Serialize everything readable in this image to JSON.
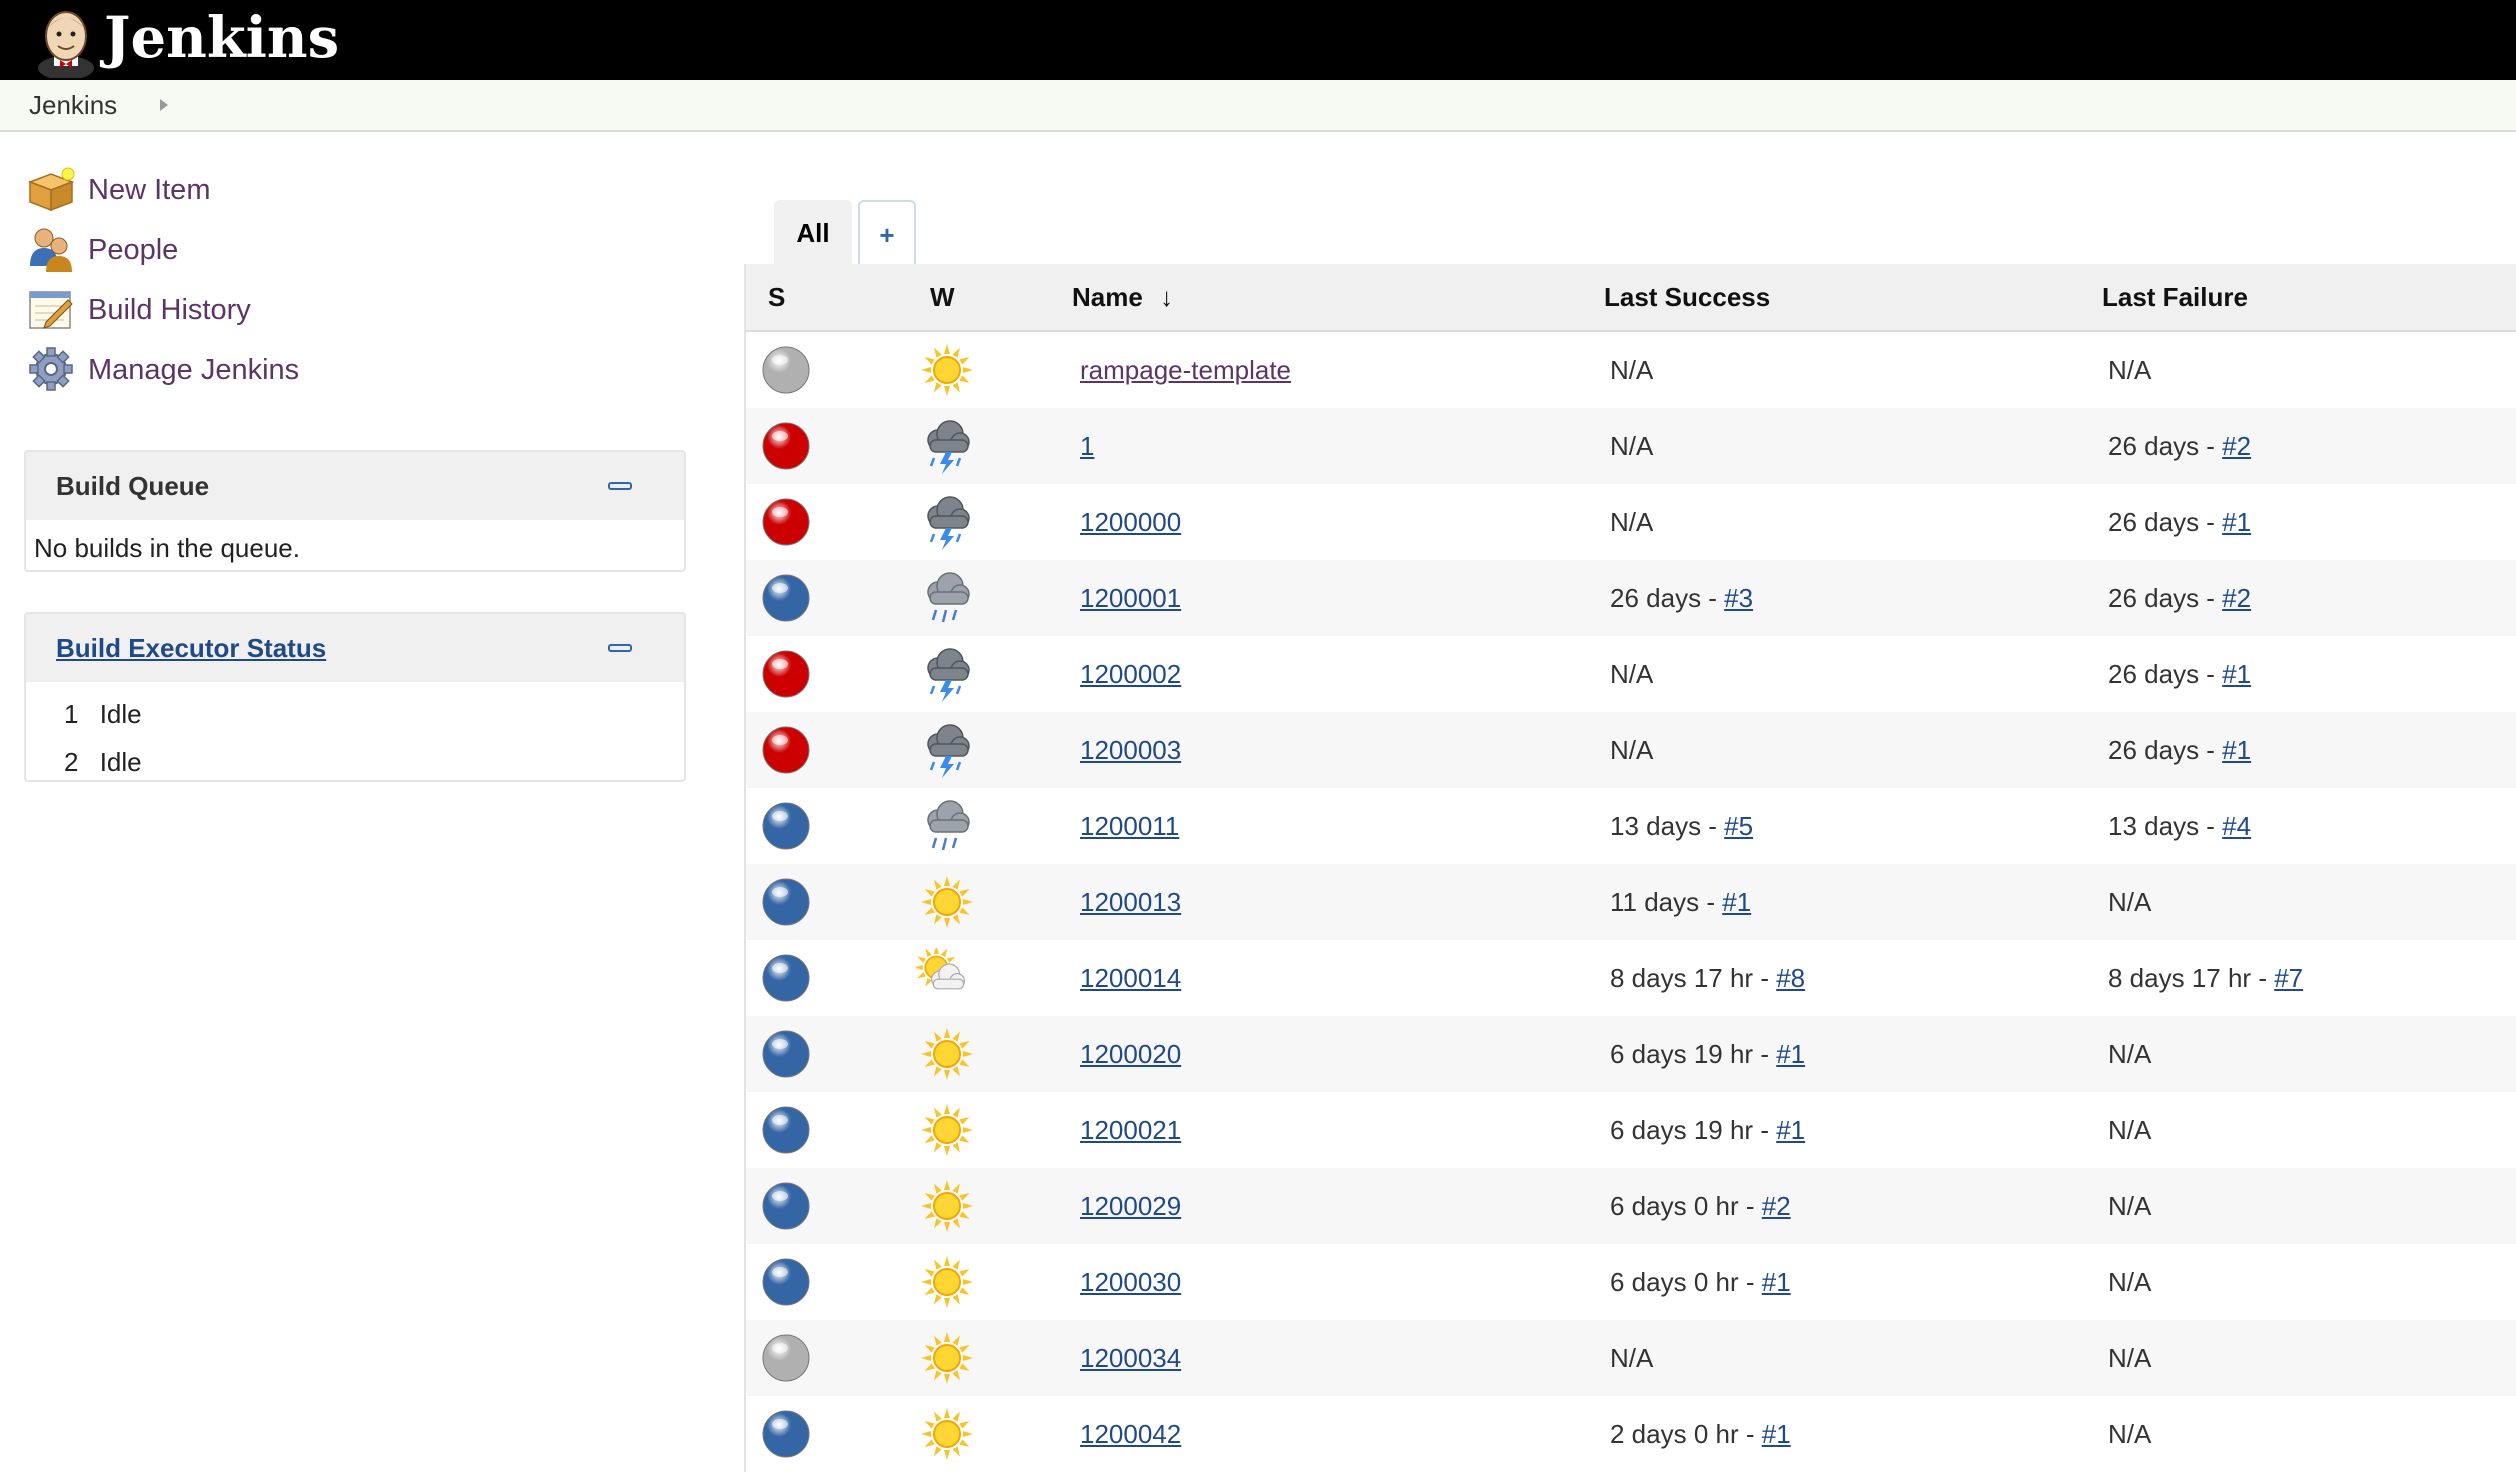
{
  "header": {
    "brand": "Jenkins",
    "logo_icon": "jenkins-butler-logo-icon"
  },
  "breadcrumb": {
    "root": "Jenkins"
  },
  "tasks": [
    {
      "label": "New Item",
      "icon": "new-item-box-icon"
    },
    {
      "label": "People",
      "icon": "people-icon"
    },
    {
      "label": "Build History",
      "icon": "notepad-icon"
    },
    {
      "label": "Manage Jenkins",
      "icon": "gear-icon"
    }
  ],
  "build_queue": {
    "title": "Build Queue",
    "empty_text": "No builds in the queue."
  },
  "executors": {
    "title": "Build Executor Status",
    "rows": [
      {
        "num": "1",
        "status": "Idle"
      },
      {
        "num": "2",
        "status": "Idle"
      }
    ]
  },
  "tabs": {
    "all": "All",
    "add": "+"
  },
  "table": {
    "headers": {
      "s": "S",
      "w": "W",
      "name": "Name",
      "sort": "↓",
      "last_success": "Last Success",
      "last_failure": "Last Failure"
    },
    "rows": [
      {
        "name": "rampage-template",
        "status": "disabled",
        "weather": "sunny",
        "success_text": "N/A",
        "success_link": "",
        "failure_text": "N/A",
        "failure_link": ""
      },
      {
        "name": "1",
        "status": "failed",
        "weather": "thunderstorm",
        "success_text": "N/A",
        "success_link": "",
        "failure_text": "26 days - ",
        "failure_link": "#2"
      },
      {
        "name": "1200000",
        "status": "failed",
        "weather": "thunderstorm",
        "success_text": "N/A",
        "success_link": "",
        "failure_text": "26 days - ",
        "failure_link": "#1"
      },
      {
        "name": "1200001",
        "status": "success",
        "weather": "rain",
        "success_text": "26 days - ",
        "success_link": "#3",
        "failure_text": "26 days - ",
        "failure_link": "#2"
      },
      {
        "name": "1200002",
        "status": "failed",
        "weather": "thunderstorm",
        "success_text": "N/A",
        "success_link": "",
        "failure_text": "26 days - ",
        "failure_link": "#1"
      },
      {
        "name": "1200003",
        "status": "failed",
        "weather": "thunderstorm",
        "success_text": "N/A",
        "success_link": "",
        "failure_text": "26 days - ",
        "failure_link": "#1"
      },
      {
        "name": "1200011",
        "status": "success",
        "weather": "rain",
        "success_text": "13 days - ",
        "success_link": "#5",
        "failure_text": "13 days - ",
        "failure_link": "#4"
      },
      {
        "name": "1200013",
        "status": "success",
        "weather": "sunny",
        "success_text": "11 days - ",
        "success_link": "#1",
        "failure_text": "N/A",
        "failure_link": ""
      },
      {
        "name": "1200014",
        "status": "success",
        "weather": "partly-cloudy",
        "success_text": "8 days 17 hr - ",
        "success_link": "#8",
        "failure_text": "8 days 17 hr - ",
        "failure_link": "#7"
      },
      {
        "name": "1200020",
        "status": "success",
        "weather": "sunny",
        "success_text": "6 days 19 hr - ",
        "success_link": "#1",
        "failure_text": "N/A",
        "failure_link": ""
      },
      {
        "name": "1200021",
        "status": "success",
        "weather": "sunny",
        "success_text": "6 days 19 hr - ",
        "success_link": "#1",
        "failure_text": "N/A",
        "failure_link": ""
      },
      {
        "name": "1200029",
        "status": "success",
        "weather": "sunny",
        "success_text": "6 days 0 hr - ",
        "success_link": "#2",
        "failure_text": "N/A",
        "failure_link": ""
      },
      {
        "name": "1200030",
        "status": "success",
        "weather": "sunny",
        "success_text": "6 days 0 hr - ",
        "success_link": "#1",
        "failure_text": "N/A",
        "failure_link": ""
      },
      {
        "name": "1200034",
        "status": "disabled",
        "weather": "sunny",
        "success_text": "N/A",
        "success_link": "",
        "failure_text": "N/A",
        "failure_link": ""
      },
      {
        "name": "1200042",
        "status": "success",
        "weather": "sunny",
        "success_text": "2 days 0 hr - ",
        "success_link": "#1",
        "failure_text": "N/A",
        "failure_link": ""
      }
    ]
  },
  "colors": {
    "header_bg": "#000000",
    "link": "#204a87",
    "task_link": "#5c3566",
    "status_success": "#3465a4",
    "status_failed": "#cc0000",
    "status_disabled": "#b0b0b0"
  }
}
